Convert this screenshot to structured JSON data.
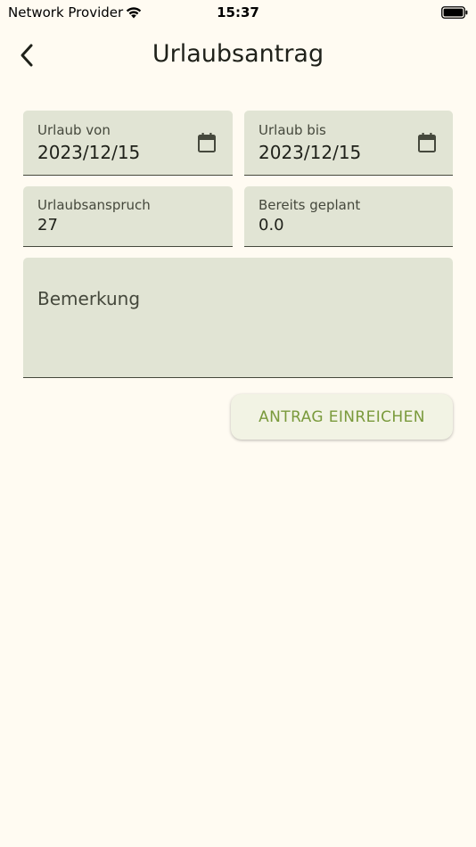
{
  "status_bar": {
    "carrier": "Network Provider",
    "time": "15:37",
    "wifi_icon": "wifi-icon",
    "battery_icon": "battery-icon"
  },
  "app_bar": {
    "title": "Urlaubsantrag",
    "back_icon": "chevron-left-icon"
  },
  "form": {
    "from": {
      "label": "Urlaub von",
      "value": "2023/12/15",
      "icon": "calendar-icon"
    },
    "to": {
      "label": "Urlaub bis",
      "value": "2023/12/15",
      "icon": "calendar-icon"
    },
    "claim": {
      "label": "Urlaubsanspruch",
      "value": "27"
    },
    "planned": {
      "label": "Bereits geplant",
      "value": "0.0"
    },
    "note": {
      "placeholder": "Bemerkung",
      "value": ""
    },
    "submit_label": "ANTRAG EINREICHEN"
  },
  "colors": {
    "background": "#fffbf2",
    "field_fill": "#e1e4d4",
    "accent": "#7a9a3c",
    "text": "#1f211a"
  }
}
